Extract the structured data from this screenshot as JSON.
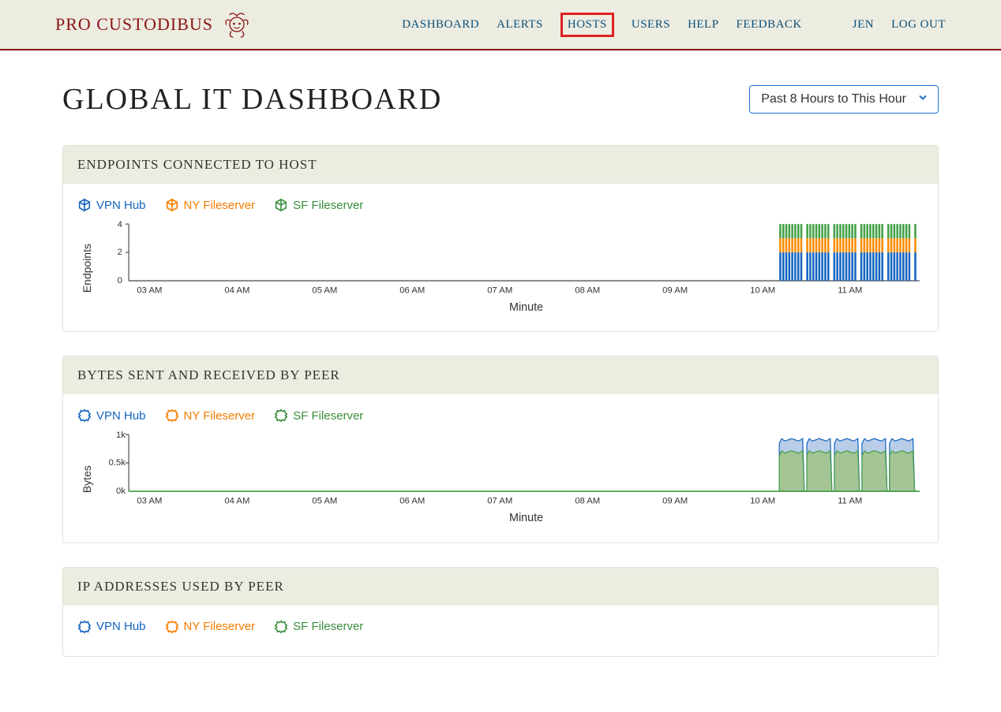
{
  "brand": "PRO CUSTODIBUS",
  "nav": {
    "dashboard": "DASHBOARD",
    "alerts": "ALERTS",
    "hosts": "HOSTS",
    "users": "USERS",
    "help": "HELP",
    "feedback": "FEEDBACK",
    "user": "JEN",
    "logout": "LOG OUT"
  },
  "page_title": "GLOBAL IT DASHBOARD",
  "range_selected": "Past 8 Hours to This Hour",
  "panels": {
    "endpoints": {
      "title": "ENDPOINTS CONNECTED TO HOST",
      "legend": {
        "vpn": "VPN Hub",
        "ny": "NY Fileserver",
        "sf": "SF Fileserver"
      },
      "ylabel": "Endpoints",
      "xlabel": "Minute"
    },
    "bytes": {
      "title": "BYTES SENT AND RECEIVED BY PEER",
      "legend": {
        "vpn": "VPN Hub",
        "ny": "NY Fileserver",
        "sf": "SF Fileserver"
      },
      "ylabel": "Bytes",
      "xlabel": "Minute"
    },
    "ips": {
      "title": "IP ADDRESSES USED BY PEER",
      "legend": {
        "vpn": "VPN Hub",
        "ny": "NY Fileserver",
        "sf": "SF Fileserver"
      }
    }
  },
  "colors": {
    "blue": "#1565c0",
    "orange": "#fb8c00",
    "green": "#43a047",
    "area_blue": "#b9cde8",
    "area_green": "#a4c496"
  },
  "chart_data": [
    {
      "type": "bar",
      "title": "ENDPOINTS CONNECTED TO HOST",
      "xlabel": "Minute",
      "ylabel": "Endpoints",
      "ylim": [
        0,
        4
      ],
      "yticks": [
        0,
        2,
        4
      ],
      "x_categories": [
        "03 AM",
        "04 AM",
        "05 AM",
        "06 AM",
        "07 AM",
        "08 AM",
        "09 AM",
        "10 AM",
        "11 AM"
      ],
      "series": [
        {
          "name": "VPN Hub",
          "color": "#1565c0",
          "value_after_10_20": 2
        },
        {
          "name": "NY Fileserver",
          "color": "#fb8c00",
          "value_after_10_20": 1
        },
        {
          "name": "SF Fileserver",
          "color": "#43a047",
          "value_after_10_20": 1
        }
      ],
      "note": "Stacked bars; all series zero until ~10:20 AM, then constant totals of 4 with periodic brief gaps (≈ every 10 min)."
    },
    {
      "type": "area",
      "title": "BYTES SENT AND RECEIVED BY PEER",
      "xlabel": "Minute",
      "ylabel": "Bytes",
      "ylim": [
        0,
        1000
      ],
      "yticks": [
        "0k",
        "0.5k",
        "1k"
      ],
      "x_categories": [
        "03 AM",
        "04 AM",
        "05 AM",
        "06 AM",
        "07 AM",
        "08 AM",
        "09 AM",
        "10 AM",
        "11 AM"
      ],
      "series": [
        {
          "name": "VPN Hub",
          "color": "#1565c0",
          "peak": 950
        },
        {
          "name": "NY Fileserver",
          "color": "#fb8c00",
          "peak": 750
        },
        {
          "name": "SF Fileserver",
          "color": "#43a047",
          "peak": 750
        }
      ],
      "note": "Areas zero until ~10:20 AM, then oscillating near 0.75k–1k with periodic dips to 0 roughly every 10 minutes."
    }
  ]
}
